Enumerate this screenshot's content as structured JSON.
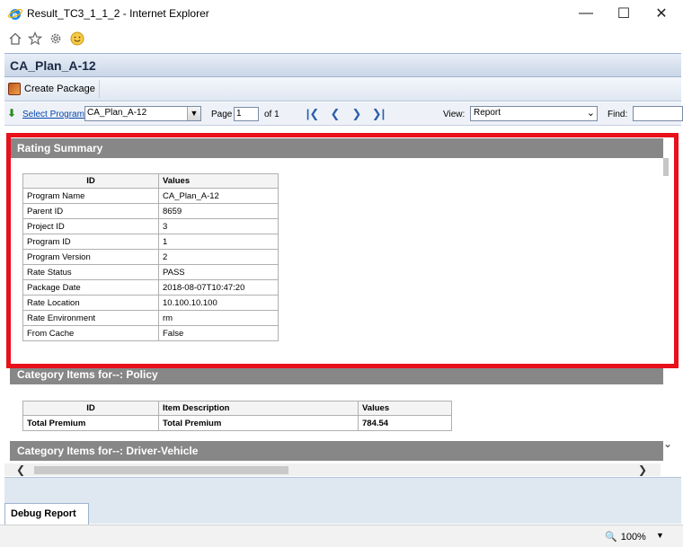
{
  "window": {
    "title": "Result_TC3_1_1_2 - Internet Explorer",
    "minimize_glyph": "—",
    "maximize_glyph": "☐",
    "close_glyph": "✕"
  },
  "browser_toolbar": {
    "icons": [
      "home-icon",
      "favorites-star-icon",
      "settings-gear-icon",
      "smiley-feedback-icon"
    ]
  },
  "app": {
    "title": "CA_Plan_A-12",
    "create_package_label": "Create Package"
  },
  "nav": {
    "select_program_label": "Select Program:",
    "program_value": "CA_Plan_A-12",
    "page_label": "Page",
    "page_value": "1",
    "of_label": "of 1",
    "view_label": "View:",
    "view_value": "Report",
    "find_label": "Find:",
    "find_value": ""
  },
  "report": {
    "rating_summary": {
      "title": "Rating Summary",
      "headers": [
        "ID",
        "Values"
      ],
      "rows": [
        [
          "Program Name",
          "CA_Plan_A-12"
        ],
        [
          "Parent ID",
          "8659"
        ],
        [
          "Project ID",
          "3"
        ],
        [
          "Program ID",
          "1"
        ],
        [
          "Program Version",
          "2"
        ],
        [
          "Rate Status",
          "PASS"
        ],
        [
          "Package Date",
          "2018-08-07T10:47:20"
        ],
        [
          "Rate Location",
          "10.100.10.100"
        ],
        [
          "Rate Environment",
          "rm"
        ],
        [
          "From Cache",
          "False"
        ]
      ]
    },
    "policy": {
      "title": "Category Items for--: Policy",
      "headers": [
        "ID",
        "Item Description",
        "Values"
      ],
      "rows": [
        [
          "Total Premium",
          "Total Premium",
          "784.54"
        ]
      ]
    },
    "driver_vehicle": {
      "title": "Category Items for--: Driver-Vehicle"
    }
  },
  "tabs": {
    "debug_report_label": "Debug Report"
  },
  "status": {
    "zoom_label": "100%"
  },
  "colors": {
    "highlight": "#e8101a",
    "section_header": "#878787",
    "link": "#0645ad"
  }
}
